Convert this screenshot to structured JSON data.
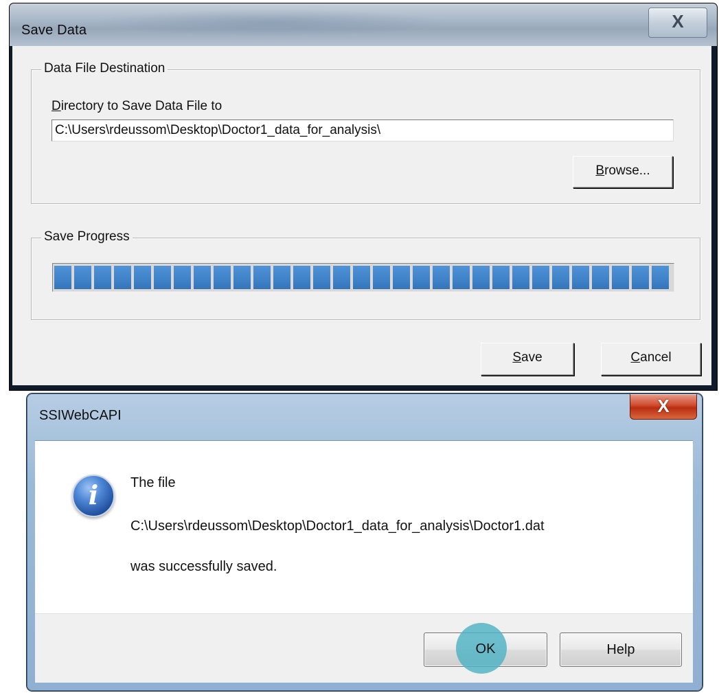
{
  "save_dialog": {
    "title": "Save Data",
    "close_glyph": "X",
    "destination_group": {
      "legend": "Data File Destination",
      "field_label_mnemonic": "D",
      "field_label_rest": "irectory to Save Data File to",
      "directory_value": "C:\\Users\\rdeussom\\Desktop\\Doctor1_data_for_analysis\\",
      "browse_mnemonic": "B",
      "browse_rest": "rowse..."
    },
    "progress_group": {
      "legend": "Save Progress",
      "progress_fraction": 1.0
    },
    "buttons": {
      "save_mnemonic": "S",
      "save_rest": "ave",
      "cancel_mnemonic": "C",
      "cancel_rest": "ancel"
    }
  },
  "message_dialog": {
    "title": "SSIWebCAPI",
    "close_glyph": "X",
    "icon": "info-icon",
    "icon_glyph": "i",
    "line1": "The file",
    "line2": "C:\\Users\\rdeussom\\Desktop\\Doctor1_data_for_analysis\\Doctor1.dat",
    "line3": "was successfully saved.",
    "ok_label": "OK",
    "help_label": "Help"
  },
  "colors": {
    "progress_blue": "#3f82c8",
    "click_marker": "#4eb2c4",
    "close_red": "#cf4a2c"
  }
}
